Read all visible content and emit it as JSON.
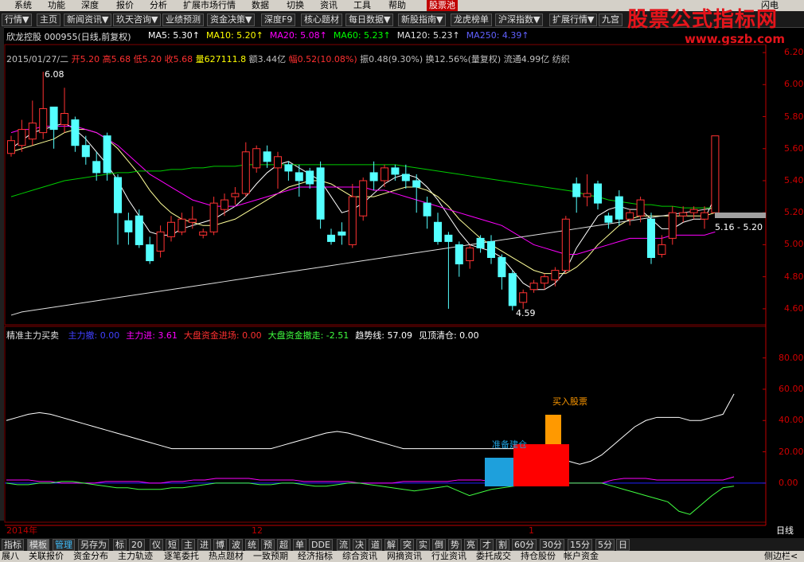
{
  "menu": [
    "系统",
    "功能",
    "深度",
    "报价",
    "分析",
    "扩展市场行情",
    "数据",
    "切换",
    "资讯",
    "工具",
    "帮助",
    "股票池",
    "闪电"
  ],
  "toolbar": [
    "行情▼",
    "主页",
    "新闻资讯▼",
    "玖天咨询▼",
    "业绩预测",
    "资金决策▼",
    "深度F9",
    "核心题材",
    "每日数据▼",
    "新股指南▼",
    "龙虎榜单",
    "沪深指数▼",
    "扩展行情▼",
    "九宫"
  ],
  "watermark": {
    "title": "股票公式指标网",
    "url": "www.gszb.com"
  },
  "stock": {
    "name": "欣龙控股",
    "code": "000955",
    "mode": "(日线,前复权)"
  },
  "ma": [
    {
      "label": "MA5: 5.30",
      "color": "#ffffff"
    },
    {
      "label": "MA10: 5.20",
      "color": "#ffff00"
    },
    {
      "label": "MA20: 5.08",
      "color": "#ff00ff"
    },
    {
      "label": "MA60: 5.23",
      "color": "#00ff00"
    },
    {
      "label": "MA120: 5.23",
      "color": "#e0e0e0"
    },
    {
      "label": "MA250: 4.39",
      "color": "#6060ff"
    }
  ],
  "bar_info": {
    "date": "2015/01/27/二",
    "open": "开5.20",
    "high": "高5.68",
    "low": "低5.20",
    "close": "收5.68",
    "vol": "量627111.8",
    "amt": "额3.44亿",
    "chg": "幅0.52(10.08%)",
    "amp": "振0.48(9.30%)",
    "turn": "换12.56%(量复权)",
    "float": "流通4.99亿",
    "sector": "纺织"
  },
  "price_annotations": {
    "high": "6.08",
    "low": "4.59",
    "range": "5.16 - 5.20"
  },
  "indicator": {
    "name": "精准主力买卖",
    "items": [
      {
        "label": "主力撤: 0.00",
        "color": "#4040ff"
      },
      {
        "label": "主力进: 3.61",
        "color": "#ff00ff"
      },
      {
        "label": "大盘资金进场: 0.00",
        "color": "#ff3030"
      },
      {
        "label": "大盘资金撤走: -2.51",
        "color": "#40ff40"
      },
      {
        "label": "趋势线: 57.09",
        "color": "#ffffff"
      },
      {
        "label": "见顶清仓: 0.00",
        "color": "#ffffff"
      }
    ],
    "labels": {
      "prepare": "准备建仓",
      "buy": "买入股票"
    }
  },
  "chart_data": [
    {
      "type": "candlestick",
      "title": "",
      "ylim": [
        4.5,
        6.25
      ],
      "yticks": [
        "6.20",
        "6.00",
        "5.80",
        "5.60",
        "5.40",
        "5.20",
        "5.00",
        "4.80",
        "4.60"
      ],
      "candles": [
        [
          5.57,
          5.68,
          5.65,
          5.55
        ],
        [
          5.62,
          5.78,
          5.72,
          5.58
        ],
        [
          5.66,
          5.9,
          5.76,
          5.62
        ],
        [
          5.7,
          6.08,
          5.85,
          5.66
        ],
        [
          5.86,
          5.86,
          5.72,
          5.6
        ],
        [
          5.75,
          5.98,
          5.82,
          5.7
        ],
        [
          5.78,
          5.8,
          5.62,
          5.58
        ],
        [
          5.62,
          5.68,
          5.55,
          5.5
        ],
        [
          5.52,
          5.58,
          5.45,
          5.4
        ],
        [
          5.68,
          5.7,
          5.45,
          5.4
        ],
        [
          5.42,
          5.44,
          5.2,
          5.0
        ],
        [
          5.15,
          5.2,
          5.08,
          5.0
        ],
        [
          5.18,
          5.22,
          5.0,
          4.98
        ],
        [
          5.0,
          5.05,
          4.9,
          4.88
        ],
        [
          4.96,
          5.12,
          5.08,
          4.92
        ],
        [
          5.05,
          5.18,
          5.14,
          5.02
        ],
        [
          5.08,
          5.2,
          5.16,
          5.06
        ],
        [
          5.14,
          5.24,
          5.16,
          5.1
        ],
        [
          5.06,
          5.1,
          5.08,
          5.04
        ],
        [
          5.08,
          5.3,
          5.26,
          5.06
        ],
        [
          5.22,
          5.32,
          5.28,
          5.18
        ],
        [
          5.3,
          5.36,
          5.32,
          5.25
        ],
        [
          5.32,
          5.64,
          5.58,
          5.3
        ],
        [
          5.48,
          5.62,
          5.6,
          5.45
        ],
        [
          5.58,
          5.62,
          5.52,
          5.48
        ],
        [
          5.48,
          5.58,
          5.55,
          5.35
        ],
        [
          5.5,
          5.52,
          5.46,
          5.4
        ],
        [
          5.45,
          5.5,
          5.4,
          5.3
        ],
        [
          5.46,
          5.48,
          5.38,
          5.35
        ],
        [
          5.48,
          5.52,
          5.16,
          5.1
        ],
        [
          5.06,
          5.1,
          5.02,
          5.0
        ],
        [
          5.08,
          5.14,
          5.06,
          5.0
        ],
        [
          5.0,
          5.38,
          5.3,
          4.98
        ],
        [
          5.18,
          5.42,
          5.4,
          5.15
        ],
        [
          5.45,
          5.52,
          5.4,
          5.34
        ],
        [
          5.4,
          5.5,
          5.48,
          5.36
        ],
        [
          5.48,
          5.5,
          5.44,
          5.4
        ],
        [
          5.44,
          5.5,
          5.4,
          5.35
        ],
        [
          5.4,
          5.44,
          5.36,
          5.2
        ],
        [
          5.26,
          5.3,
          5.18,
          5.1
        ],
        [
          5.14,
          5.2,
          5.02,
          5.0
        ],
        [
          5.06,
          5.08,
          5.02,
          4.6
        ],
        [
          5.0,
          5.02,
          4.88,
          4.8
        ],
        [
          4.9,
          5.0,
          4.98,
          4.85
        ],
        [
          5.04,
          5.06,
          4.98,
          4.95
        ],
        [
          5.02,
          5.06,
          4.92,
          4.88
        ],
        [
          4.92,
          4.94,
          4.8,
          4.72
        ],
        [
          4.82,
          4.84,
          4.62,
          4.59
        ],
        [
          4.64,
          4.72,
          4.7,
          4.6
        ],
        [
          4.72,
          4.78,
          4.76,
          4.7
        ],
        [
          4.76,
          4.82,
          4.8,
          4.72
        ],
        [
          4.78,
          4.86,
          4.84,
          4.74
        ],
        [
          4.84,
          5.18,
          5.16,
          4.82
        ],
        [
          5.38,
          5.42,
          5.3,
          5.2
        ],
        [
          5.3,
          5.44,
          5.32,
          5.24
        ],
        [
          5.38,
          5.4,
          5.26,
          5.22
        ],
        [
          5.18,
          5.2,
          5.14,
          5.1
        ],
        [
          5.3,
          5.34,
          5.16,
          5.12
        ],
        [
          5.16,
          5.22,
          5.2,
          5.12
        ],
        [
          5.18,
          5.3,
          5.28,
          5.14
        ],
        [
          5.16,
          5.2,
          4.92,
          4.88
        ],
        [
          4.94,
          5.06,
          5.0,
          4.92
        ],
        [
          5.04,
          5.24,
          5.2,
          5.0
        ],
        [
          5.18,
          5.24,
          5.2,
          5.14
        ],
        [
          5.2,
          5.24,
          5.22,
          5.16
        ],
        [
          5.16,
          5.24,
          5.2,
          5.1
        ],
        [
          5.2,
          5.68,
          5.68,
          5.2
        ]
      ],
      "ma_lines": {
        "ma5": [
          5.6,
          5.65,
          5.7,
          5.72,
          5.74,
          5.76,
          5.72,
          5.66,
          5.58,
          5.5,
          5.4,
          5.28,
          5.18,
          5.08,
          5.06,
          5.06,
          5.1,
          5.12,
          5.14,
          5.16,
          5.2,
          5.24,
          5.3,
          5.38,
          5.45,
          5.5,
          5.52,
          5.48,
          5.44,
          5.4,
          5.3,
          5.2,
          5.22,
          5.26,
          5.32,
          5.38,
          5.42,
          5.44,
          5.42,
          5.36,
          5.28,
          5.18,
          5.08,
          5.0,
          4.98,
          4.96,
          4.92,
          4.84,
          4.76,
          4.72,
          4.72,
          4.76,
          4.84,
          4.98,
          5.08,
          5.18,
          5.22,
          5.24,
          5.22,
          5.22,
          5.16,
          5.1,
          5.1,
          5.14,
          5.16,
          5.16,
          5.3
        ],
        "ma10": [
          5.58,
          5.6,
          5.62,
          5.64,
          5.66,
          5.7,
          5.72,
          5.72,
          5.7,
          5.66,
          5.6,
          5.52,
          5.44,
          5.34,
          5.26,
          5.2,
          5.16,
          5.14,
          5.12,
          5.12,
          5.14,
          5.16,
          5.2,
          5.24,
          5.28,
          5.32,
          5.36,
          5.38,
          5.4,
          5.4,
          5.38,
          5.34,
          5.3,
          5.3,
          5.3,
          5.32,
          5.34,
          5.36,
          5.36,
          5.34,
          5.3,
          5.24,
          5.16,
          5.1,
          5.04,
          5.0,
          4.96,
          4.92,
          4.88,
          4.84,
          4.82,
          4.82,
          4.82,
          4.86,
          4.92,
          5.0,
          5.06,
          5.12,
          5.16,
          5.18,
          5.18,
          5.18,
          5.18,
          5.18,
          5.18,
          5.18,
          5.2
        ],
        "ma20": [
          5.7,
          5.72,
          5.72,
          5.74,
          5.74,
          5.74,
          5.74,
          5.72,
          5.7,
          5.66,
          5.62,
          5.56,
          5.5,
          5.44,
          5.4,
          5.36,
          5.32,
          5.28,
          5.26,
          5.24,
          5.24,
          5.24,
          5.26,
          5.28,
          5.3,
          5.32,
          5.34,
          5.36,
          5.36,
          5.36,
          5.36,
          5.36,
          5.36,
          5.36,
          5.34,
          5.34,
          5.32,
          5.3,
          5.28,
          5.26,
          5.24,
          5.22,
          5.2,
          5.18,
          5.16,
          5.14,
          5.12,
          5.08,
          5.04,
          5.0,
          4.98,
          4.96,
          4.94,
          4.94,
          4.96,
          4.98,
          5.0,
          5.02,
          5.04,
          5.04,
          5.04,
          5.04,
          5.06,
          5.06,
          5.06,
          5.06,
          5.08
        ],
        "ma60": [
          5.3,
          5.32,
          5.34,
          5.36,
          5.38,
          5.4,
          5.41,
          5.42,
          5.43,
          5.44,
          5.45,
          5.45,
          5.46,
          5.46,
          5.46,
          5.47,
          5.47,
          5.48,
          5.48,
          5.49,
          5.49,
          5.49,
          5.5,
          5.5,
          5.5,
          5.5,
          5.5,
          5.5,
          5.5,
          5.5,
          5.5,
          5.5,
          5.5,
          5.5,
          5.5,
          5.5,
          5.5,
          5.49,
          5.48,
          5.47,
          5.46,
          5.45,
          5.44,
          5.43,
          5.42,
          5.41,
          5.4,
          5.39,
          5.38,
          5.37,
          5.36,
          5.35,
          5.34,
          5.33,
          5.31,
          5.3,
          5.28,
          5.27,
          5.26,
          5.25,
          5.25,
          5.24,
          5.24,
          5.23,
          5.23,
          5.23,
          5.23
        ],
        "ma120": [
          4.56,
          4.58,
          4.59,
          4.6,
          4.61,
          4.62,
          4.63,
          4.64,
          4.65,
          4.66,
          4.67,
          4.68,
          4.69,
          4.7,
          4.71,
          4.72,
          4.73,
          4.74,
          4.75,
          4.76,
          4.77,
          4.78,
          4.79,
          4.8,
          4.81,
          4.82,
          4.83,
          4.84,
          4.85,
          4.86,
          4.87,
          4.88,
          4.89,
          4.9,
          4.91,
          4.92,
          4.93,
          4.94,
          4.95,
          4.96,
          4.97,
          4.98,
          4.99,
          5.0,
          5.01,
          5.02,
          5.03,
          5.04,
          5.05,
          5.06,
          5.07,
          5.08,
          5.09,
          5.1,
          5.11,
          5.12,
          5.13,
          5.14,
          5.15,
          5.16,
          5.17,
          5.18,
          5.19,
          5.2,
          5.21,
          5.22,
          5.23
        ]
      }
    },
    {
      "type": "line",
      "title": "",
      "ylim": [
        -25,
        90
      ],
      "yticks": [
        "80.00",
        "60.00",
        "40.00",
        "20.00",
        "0.00"
      ],
      "series": [
        {
          "name": "趋势线",
          "color": "#ffffff",
          "values": [
            40,
            42,
            44,
            45,
            44,
            42,
            40,
            38,
            36,
            34,
            32,
            30,
            28,
            26,
            24,
            22,
            22,
            22,
            22,
            22,
            22,
            22,
            22,
            22,
            22,
            24,
            26,
            28,
            30,
            32,
            33,
            32,
            30,
            28,
            26,
            24,
            22,
            22,
            22,
            22,
            22,
            22,
            22,
            22,
            22,
            22,
            22,
            22,
            20,
            18,
            16,
            14,
            12,
            14,
            18,
            24,
            30,
            36,
            40,
            42,
            42,
            42,
            40,
            40,
            42,
            44,
            57
          ]
        },
        {
          "name": "主力进",
          "color": "#ff00ff",
          "values": [
            2,
            2,
            2,
            1,
            1,
            0,
            0,
            0,
            0,
            1,
            1,
            1,
            1,
            0,
            0,
            1,
            1,
            2,
            2,
            3,
            3,
            3,
            3,
            2,
            2,
            2,
            2,
            1,
            1,
            1,
            1,
            1,
            0,
            0,
            0,
            0,
            1,
            1,
            1,
            1,
            1,
            2,
            2,
            2,
            1,
            1,
            1,
            0,
            0,
            0,
            0,
            0,
            0,
            0,
            0,
            2,
            3,
            3,
            3,
            2,
            2,
            2,
            2,
            2,
            2,
            2,
            4
          ]
        },
        {
          "name": "大盘资金撤走",
          "color": "#40ff40",
          "values": [
            0,
            -1,
            -1,
            0,
            0,
            1,
            1,
            0,
            -1,
            -2,
            -3,
            -3,
            -4,
            -4,
            -4,
            -3,
            -3,
            -2,
            -1,
            0,
            0,
            0,
            0,
            -1,
            -1,
            0,
            0,
            -1,
            -2,
            -2,
            -1,
            0,
            0,
            -1,
            -2,
            -3,
            -4,
            -5,
            -4,
            -3,
            -2,
            -5,
            -8,
            -6,
            -4,
            -3,
            -2,
            -1,
            -1,
            -1,
            0,
            0,
            0,
            0,
            0,
            -2,
            -4,
            -6,
            -8,
            -10,
            -12,
            -18,
            -20,
            -14,
            -8,
            -3,
            -2
          ]
        }
      ]
    }
  ],
  "axis_labels": {
    "year": "2014年",
    "m12": "12",
    "m1": "1",
    "period": "日线"
  },
  "bottom_tabs": [
    "指标",
    "模板",
    "管理",
    "另存为",
    "标",
    "20",
    "仪",
    "短",
    "主",
    "进",
    "博",
    "波",
    "统",
    "预",
    "超",
    "单",
    "DDE",
    "流",
    "决",
    "道",
    "解",
    "突",
    "实",
    "倒",
    "势",
    "亮",
    "才",
    "割",
    "60分",
    "30分",
    "15分",
    "5分",
    "日"
  ],
  "status": [
    "展八",
    "关联报价",
    "资金分布",
    "主力轨迹",
    "逐笔委托",
    "热点题材",
    "一致预期",
    "经济指标",
    "综合资讯",
    "网摘资讯",
    "行业资讯",
    "委托成交",
    "持仓股份",
    "帐户资金",
    "侧边栏<"
  ]
}
